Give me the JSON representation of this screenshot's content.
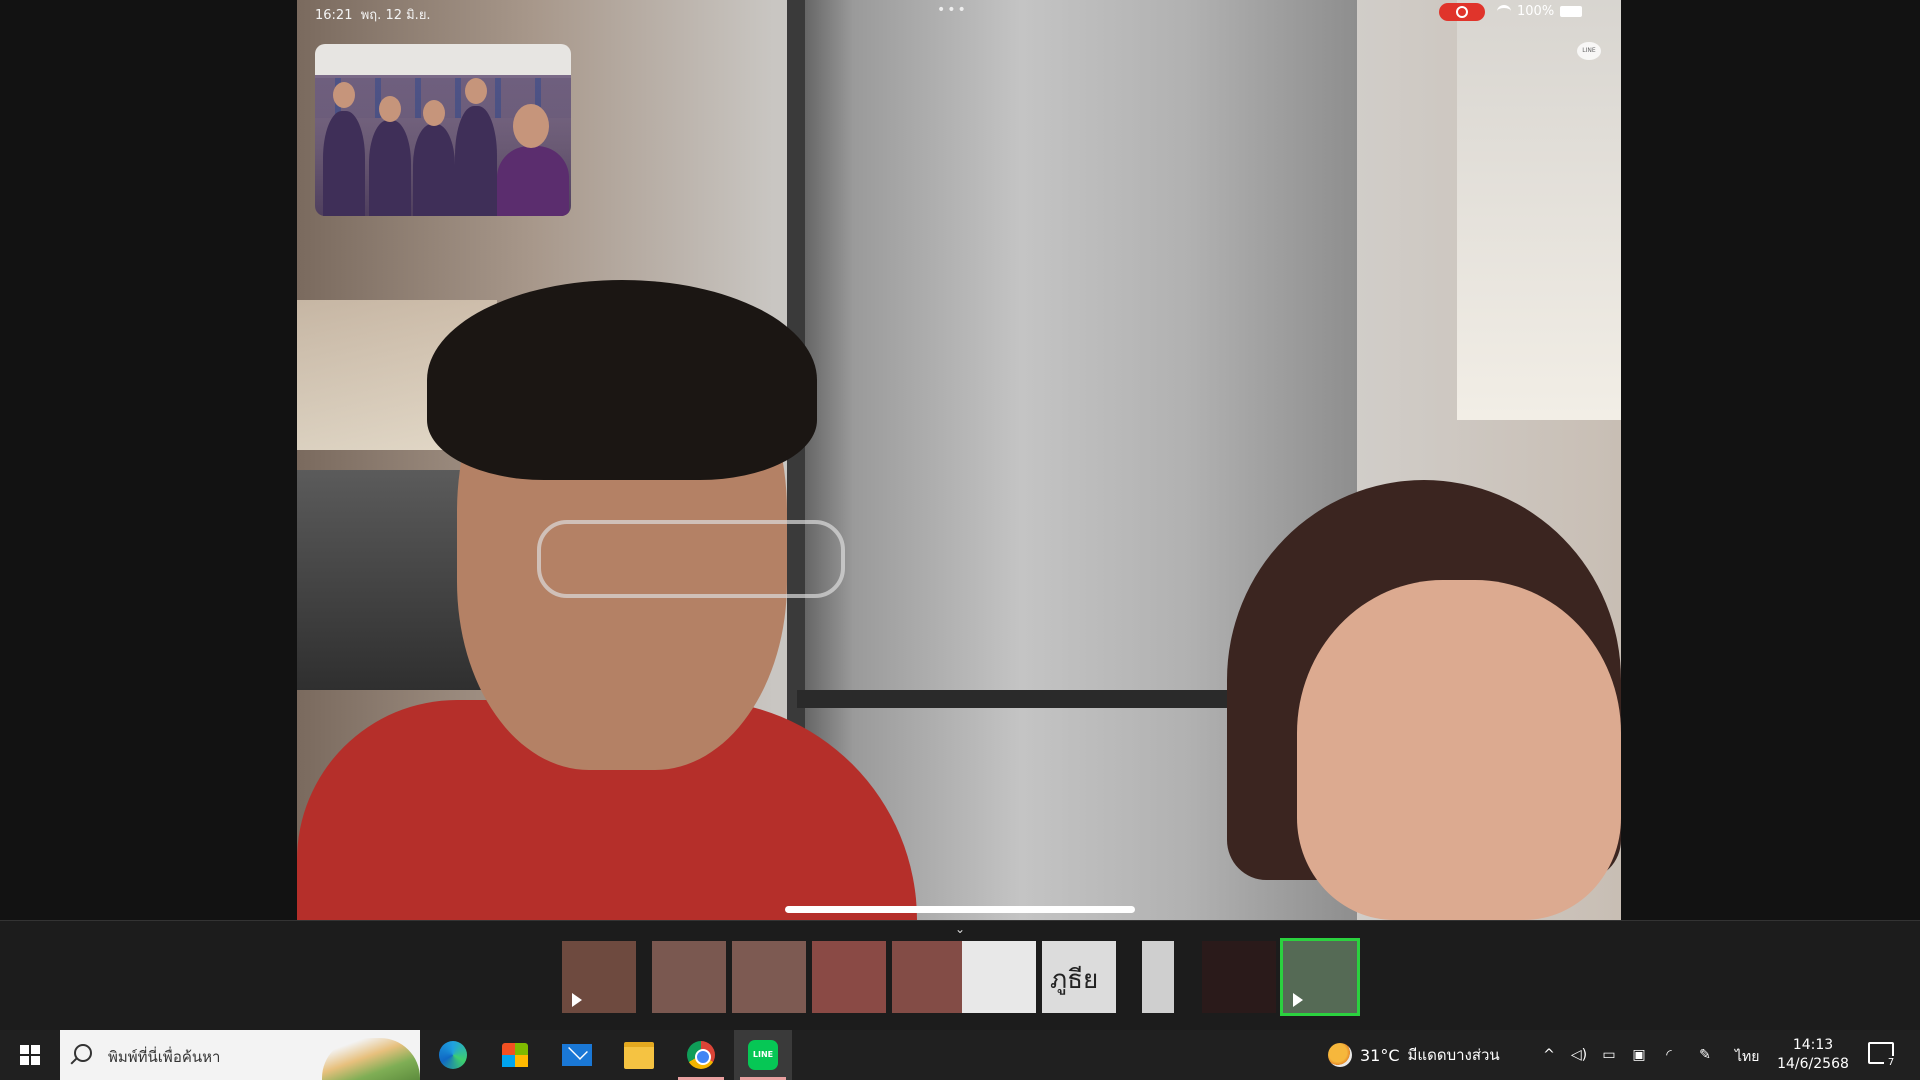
{
  "status_bar": {
    "time": "16:21",
    "date": "พฤ. 12 มิ.ย.",
    "battery": "100%"
  },
  "line_watermark": "LINE",
  "filmstrip": {
    "thumbnails": [
      {
        "kind": "video"
      },
      {
        "kind": "photo"
      },
      {
        "kind": "photo"
      },
      {
        "kind": "photo"
      },
      {
        "kind": "photo"
      },
      {
        "kind": "document"
      },
      {
        "kind": "sketch",
        "text": "ภูธีย"
      },
      {
        "kind": "document"
      },
      {
        "kind": "photo"
      },
      {
        "kind": "video",
        "selected": true
      }
    ]
  },
  "taskbar": {
    "search_placeholder": "พิมพ์ที่นี่เพื่อค้นหา",
    "apps": [
      "edge-icon",
      "store-icon",
      "mail-icon",
      "file-explorer-icon",
      "chrome-icon",
      "line-icon"
    ],
    "weather": {
      "temp": "31°C",
      "condition": "มีแดดบางส่วน"
    },
    "language": "ไทย",
    "clock": {
      "time": "14:13",
      "date": "14/6/2568"
    },
    "notifications": "7"
  },
  "colors": {
    "selected_outline": "#2bd13f",
    "line_green": "#06c755",
    "record_red": "#e0342b"
  }
}
